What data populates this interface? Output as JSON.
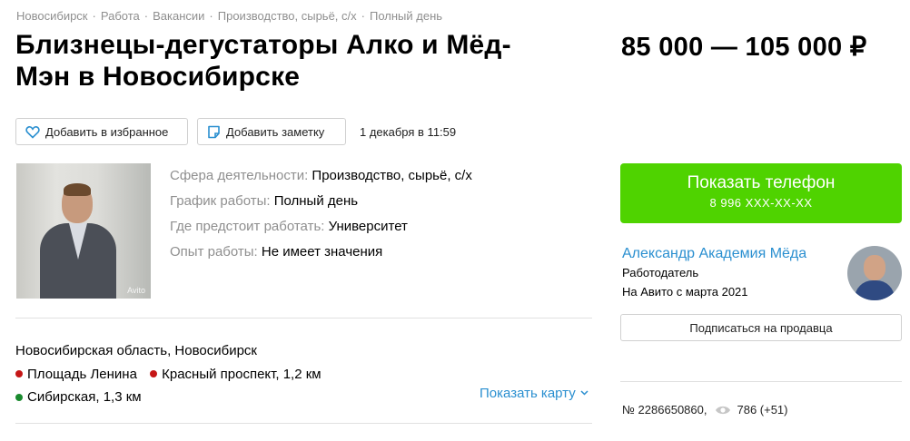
{
  "breadcrumbs": [
    "Новосибирск",
    "Работа",
    "Вакансии",
    "Производство, сырьё, с/х",
    "Полный день"
  ],
  "title": "Близнецы-дегустаторы Алко и Мёд-Мэн в Новосибирске",
  "price": "85 000 — 105 000 ₽",
  "actions": {
    "favorite_label": "Добавить в избранное",
    "note_label": "Добавить заметку",
    "date": "1 декабря в 11:59"
  },
  "photo": {
    "watermark": "Avito"
  },
  "params": [
    {
      "key": "Сфера деятельности: ",
      "value": "Производство, сырьё, с/х"
    },
    {
      "key": "График работы: ",
      "value": "Полный день"
    },
    {
      "key": "Где предстоит работать: ",
      "value": "Университет"
    },
    {
      "key": "Опыт работы: ",
      "value": "Не имеет значения"
    }
  ],
  "location": {
    "address": "Новосибирская область, Новосибирск",
    "metro": [
      {
        "name": "Площадь Ленина",
        "distance": "",
        "color": "#c51616"
      },
      {
        "name": "Красный проспект, 1,2 км",
        "distance": "",
        "color": "#c51616"
      },
      {
        "name": "Сибирская, 1,3 км",
        "distance": "",
        "color": "#1a8a2e"
      }
    ],
    "show_map_label": "Показать карту"
  },
  "phone": {
    "label": "Показать телефон",
    "number": "8 996 XXX-XX-XX",
    "color": "#4fd300"
  },
  "seller": {
    "name": "Александр Академия Мёда",
    "role": "Работодатель",
    "since": "На Авито с марта 2021",
    "subscribe_label": "Подписаться на продавца"
  },
  "stats": {
    "ad_number": "№ 2286650860,",
    "views": "786 (+51)"
  },
  "colors": {
    "accent_link": "#2a8fd0",
    "muted": "#8f8f8f"
  }
}
